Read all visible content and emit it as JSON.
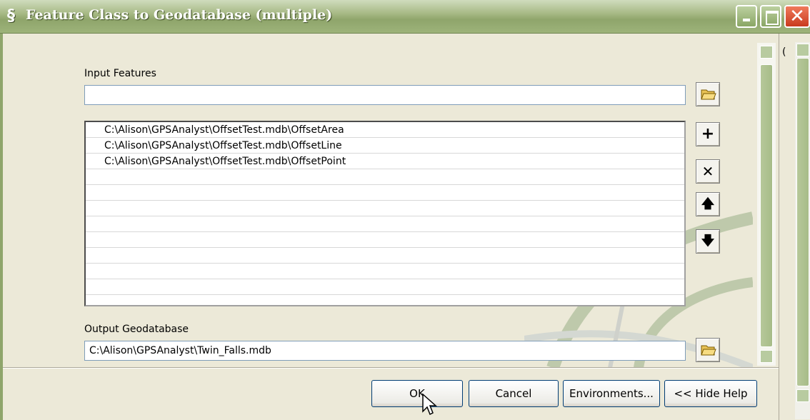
{
  "window": {
    "title": "Feature Class to Geodatabase (multiple)"
  },
  "form": {
    "input_label": "Input Features",
    "input_value": "",
    "items": [
      "C:\\Alison\\GPSAnalyst\\OffsetTest.mdb\\OffsetArea",
      "C:\\Alison\\GPSAnalyst\\OffsetTest.mdb\\OffsetLine",
      "C:\\Alison\\GPSAnalyst\\OffsetTest.mdb\\OffsetPoint",
      "",
      "",
      "",
      "",
      "",
      "",
      "",
      ""
    ],
    "output_label": "Output Geodatabase",
    "output_value": "C:\\Alison\\GPSAnalyst\\Twin_Falls.mdb"
  },
  "side_buttons": {
    "add": "+",
    "remove": "✕",
    "up": "🡅",
    "down": "🡇"
  },
  "buttons": {
    "ok": "OK",
    "cancel": "Cancel",
    "environments": "Environments...",
    "hide_help": "<< Hide Help"
  },
  "right_panel": {
    "fragment": "("
  },
  "colors": {
    "title_green": "#9db37a",
    "close_red": "#c93b1e",
    "face": "#ece9d8"
  }
}
